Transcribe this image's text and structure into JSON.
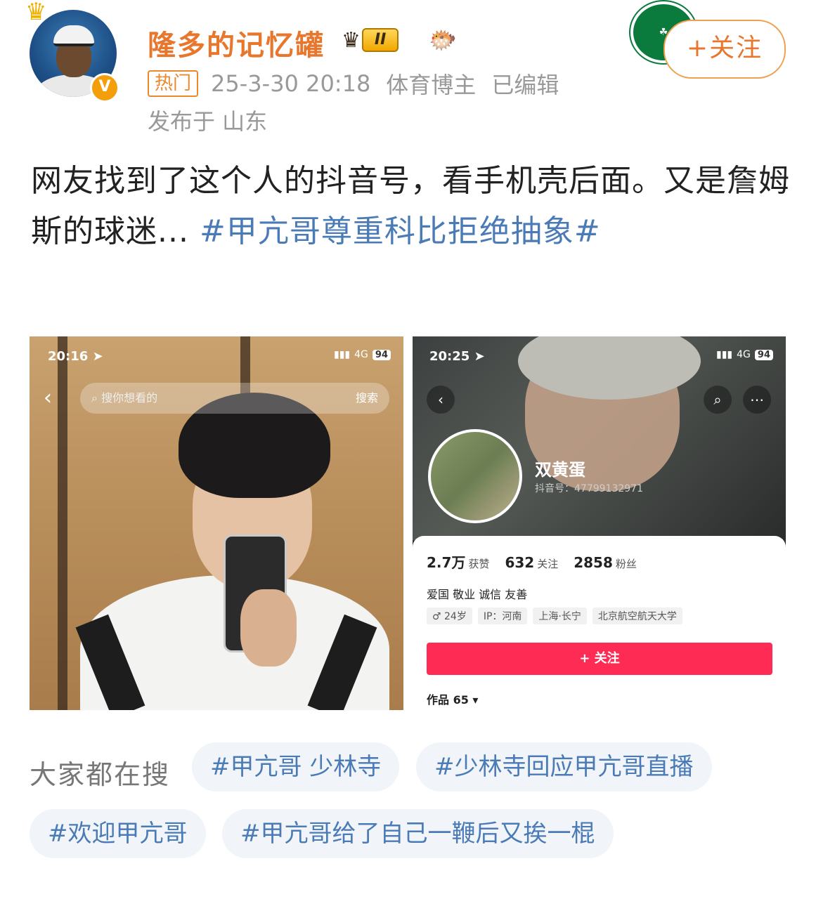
{
  "post": {
    "username": "隆多的记忆罐",
    "rank_label": "II",
    "hot_label": "热门",
    "datetime": "25-3-30 20:18",
    "role": "体育博主",
    "edited": "已编辑",
    "location": "发布于 山东",
    "follow_label": "+关注",
    "text_part1": "网友找到了这个人的抖音号，看手机壳后面。又是詹姆斯的球迷... ",
    "topic": "#甲亢哥尊重科比拒绝抽象#"
  },
  "screenshot_left": {
    "time": "20:16",
    "signal": "4G",
    "battery": "94",
    "search_placeholder": "搜你想看的",
    "search_button": "搜索"
  },
  "screenshot_right": {
    "time": "20:25",
    "signal": "4G",
    "battery": "94",
    "profile_name": "双黄蛋",
    "profile_id": "抖音号：47799132971",
    "likes_value": "2.7万",
    "likes_label": "获赞",
    "following_value": "632",
    "following_label": "关注",
    "followers_value": "2858",
    "followers_label": "粉丝",
    "bio": "爱国 敬业 诚信 友善",
    "chips": [
      "♂ 24岁",
      "IP：河南",
      "上海·长宁",
      "北京航空航天大学"
    ],
    "follow_button": "+ 关注",
    "works_label": "作品 65 ▾"
  },
  "search_section": {
    "label": "大家都在搜",
    "tags": [
      "#甲亢哥 少林寺",
      "#少林寺回应甲亢哥直播",
      "#欢迎甲亢哥",
      "#甲亢哥给了自己一鞭后又挨一棍"
    ]
  },
  "colors": {
    "username": "#e8772e",
    "topic": "#4a7bb6",
    "follow_pink": "#fe2c55"
  }
}
